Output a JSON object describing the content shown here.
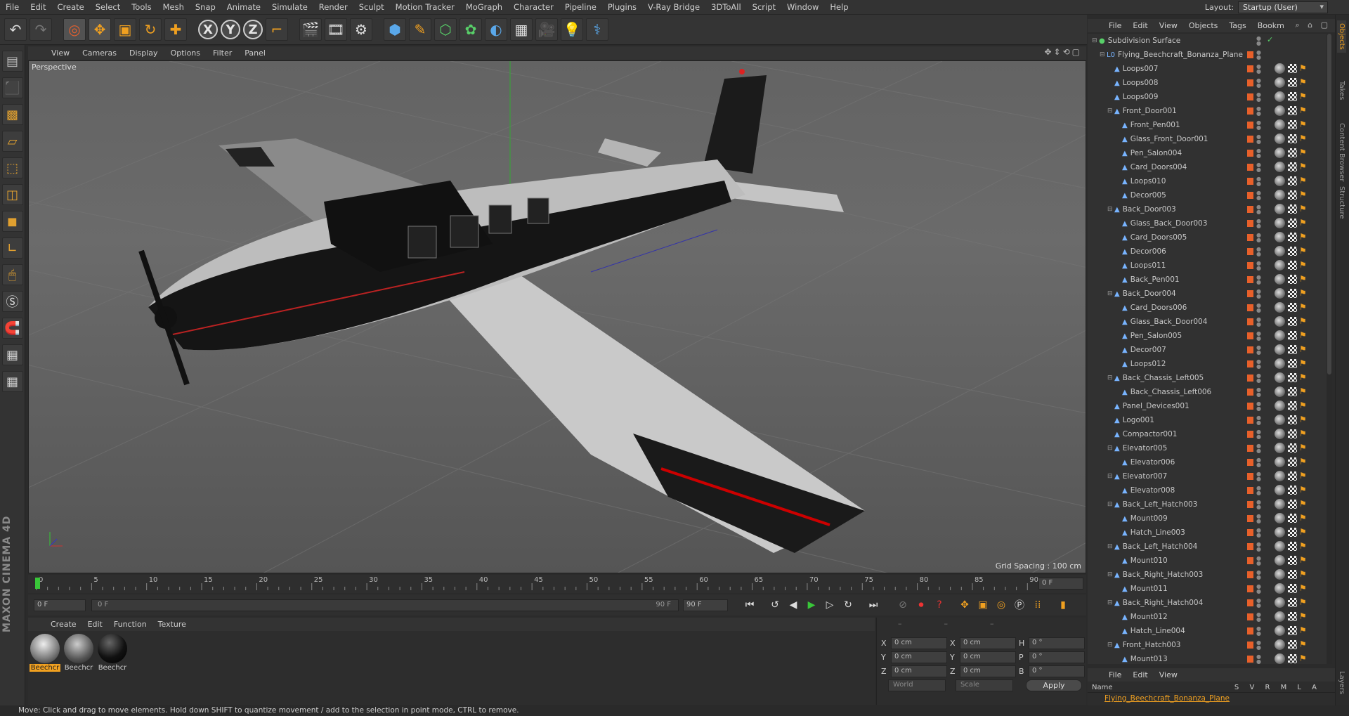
{
  "menubar": {
    "items": [
      "File",
      "Edit",
      "Create",
      "Select",
      "Tools",
      "Mesh",
      "Snap",
      "Animate",
      "Simulate",
      "Render",
      "Sculpt",
      "Motion Tracker",
      "MoGraph",
      "Character",
      "Pipeline",
      "Plugins",
      "V-Ray Bridge",
      "3DToAll",
      "Script",
      "Window",
      "Help"
    ],
    "layout_label": "Layout:",
    "layout_value": "Startup (User)"
  },
  "toolbar": {
    "undo": "undo-icon",
    "axis_x": "X",
    "axis_y": "Y",
    "axis_z": "Z"
  },
  "viewport": {
    "menu": [
      "View",
      "Cameras",
      "Display",
      "Options",
      "Filter",
      "Panel"
    ],
    "label": "Perspective",
    "grid_spacing": "Grid Spacing : 100 cm"
  },
  "timeline": {
    "ticks": [
      "0",
      "5",
      "10",
      "15",
      "20",
      "25",
      "30",
      "35",
      "40",
      "45",
      "50",
      "55",
      "60",
      "65",
      "70",
      "75",
      "80",
      "85",
      "90"
    ],
    "current_frame_field": "0 F",
    "start_field": "0 F",
    "slider_start": "0 F",
    "slider_end": "90 F",
    "end_field": "90 F"
  },
  "material_manager": {
    "menu": [
      "Create",
      "Edit",
      "Function",
      "Texture"
    ],
    "materials": [
      {
        "name": "Beechcr",
        "selected": true
      },
      {
        "name": "Beechcr",
        "selected": false
      },
      {
        "name": "Beechcr",
        "selected": false
      }
    ]
  },
  "coordinates": {
    "rows": [
      {
        "k1": "X",
        "v1": "0 cm",
        "k2": "X",
        "v2": "0 cm",
        "k3": "H",
        "v3": "0 °"
      },
      {
        "k1": "Y",
        "v1": "0 cm",
        "k2": "Y",
        "v2": "0 cm",
        "k3": "P",
        "v3": "0 °"
      },
      {
        "k1": "Z",
        "v1": "0 cm",
        "k2": "Z",
        "v2": "0 cm",
        "k3": "B",
        "v3": "0 °"
      }
    ],
    "mode": "World",
    "type": "Scale",
    "apply": "Apply"
  },
  "status": "Move: Click and drag to move elements. Hold down SHIFT to quantize movement / add to the selection in point mode, CTRL to remove.",
  "object_manager": {
    "menu": [
      "File",
      "Edit",
      "View",
      "Objects",
      "Tags",
      "Bookm"
    ],
    "objects": [
      {
        "name": "Subdivision Surface",
        "depth": 0,
        "group": true
      },
      {
        "name": "Flying_Beechcraft_Bonanza_Plane",
        "depth": 1,
        "group": true
      },
      {
        "name": "Loops007",
        "depth": 2,
        "group": false
      },
      {
        "name": "Loops008",
        "depth": 2,
        "group": false
      },
      {
        "name": "Loops009",
        "depth": 2,
        "group": false
      },
      {
        "name": "Front_Door001",
        "depth": 2,
        "group": true
      },
      {
        "name": "Front_Pen001",
        "depth": 3,
        "group": false
      },
      {
        "name": "Glass_Front_Door001",
        "depth": 3,
        "group": false
      },
      {
        "name": "Pen_Salon004",
        "depth": 3,
        "group": false
      },
      {
        "name": "Card_Doors004",
        "depth": 3,
        "group": false
      },
      {
        "name": "Loops010",
        "depth": 3,
        "group": false
      },
      {
        "name": "Decor005",
        "depth": 3,
        "group": false
      },
      {
        "name": "Back_Door003",
        "depth": 2,
        "group": true
      },
      {
        "name": "Glass_Back_Door003",
        "depth": 3,
        "group": false
      },
      {
        "name": "Card_Doors005",
        "depth": 3,
        "group": false
      },
      {
        "name": "Decor006",
        "depth": 3,
        "group": false
      },
      {
        "name": "Loops011",
        "depth": 3,
        "group": false
      },
      {
        "name": "Back_Pen001",
        "depth": 3,
        "group": false
      },
      {
        "name": "Back_Door004",
        "depth": 2,
        "group": true
      },
      {
        "name": "Card_Doors006",
        "depth": 3,
        "group": false
      },
      {
        "name": "Glass_Back_Door004",
        "depth": 3,
        "group": false
      },
      {
        "name": "Pen_Salon005",
        "depth": 3,
        "group": false
      },
      {
        "name": "Decor007",
        "depth": 3,
        "group": false
      },
      {
        "name": "Loops012",
        "depth": 3,
        "group": false
      },
      {
        "name": "Back_Chassis_Left005",
        "depth": 2,
        "group": true
      },
      {
        "name": "Back_Chassis_Left006",
        "depth": 3,
        "group": false
      },
      {
        "name": "Panel_Devices001",
        "depth": 2,
        "group": false
      },
      {
        "name": "Logo001",
        "depth": 2,
        "group": false
      },
      {
        "name": "Compactor001",
        "depth": 2,
        "group": false
      },
      {
        "name": "Elevator005",
        "depth": 2,
        "group": true
      },
      {
        "name": "Elevator006",
        "depth": 3,
        "group": false
      },
      {
        "name": "Elevator007",
        "depth": 2,
        "group": true
      },
      {
        "name": "Elevator008",
        "depth": 3,
        "group": false
      },
      {
        "name": "Back_Left_Hatch003",
        "depth": 2,
        "group": true
      },
      {
        "name": "Mount009",
        "depth": 3,
        "group": false
      },
      {
        "name": "Hatch_Line003",
        "depth": 3,
        "group": false
      },
      {
        "name": "Back_Left_Hatch004",
        "depth": 2,
        "group": true
      },
      {
        "name": "Mount010",
        "depth": 3,
        "group": false
      },
      {
        "name": "Back_Right_Hatch003",
        "depth": 2,
        "group": true
      },
      {
        "name": "Mount011",
        "depth": 3,
        "group": false
      },
      {
        "name": "Back_Right_Hatch004",
        "depth": 2,
        "group": true
      },
      {
        "name": "Mount012",
        "depth": 3,
        "group": false
      },
      {
        "name": "Hatch_Line004",
        "depth": 3,
        "group": false
      },
      {
        "name": "Front_Hatch003",
        "depth": 2,
        "group": true
      },
      {
        "name": "Mount013",
        "depth": 3,
        "group": false
      }
    ]
  },
  "layer_manager": {
    "menu": [
      "File",
      "Edit",
      "View"
    ],
    "header_name": "Name",
    "header_cols": "S V R M L A",
    "row": "Flying_Beechcraft_Bonanza_Plane"
  },
  "side_tabs": [
    "Objects",
    "Takes",
    "Content Browser",
    "Structure",
    "Layers"
  ],
  "colors": {
    "accent": "#f0a020",
    "layer_swatch": "#e8602a",
    "object_icon": "#78b4ff"
  }
}
